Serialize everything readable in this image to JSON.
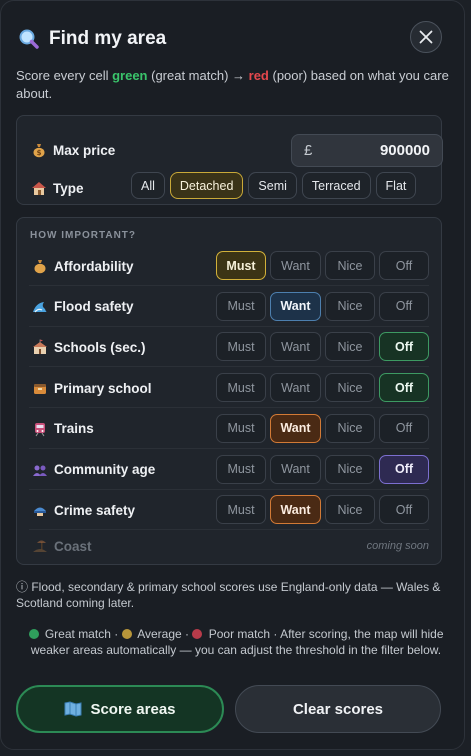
{
  "header": {
    "title": "Find my area",
    "icon": "magnifier-icon",
    "close_icon": "close-icon"
  },
  "description": {
    "part1": "Score every cell ",
    "green_word": "green",
    "part2": " (great match) → ",
    "red_word": "red",
    "part3": " (poor) based on what you care about."
  },
  "filters": {
    "max_price_label": "Max price",
    "currency": "£",
    "max_price_value": "900000",
    "type_label": "Type",
    "types": [
      "All",
      "Detached",
      "Semi",
      "Terraced",
      "Flat"
    ],
    "selected_type": "Detached"
  },
  "importance": {
    "heading": "HOW IMPORTANT?",
    "options": [
      "Must",
      "Want",
      "Nice",
      "Off"
    ],
    "rows": [
      {
        "label": "Affordability",
        "selected": "Must"
      },
      {
        "label": "Flood safety",
        "selected": "Want"
      },
      {
        "label": "Schools (sec.)",
        "selected": "Off"
      },
      {
        "label": "Primary school",
        "selected": "Off"
      },
      {
        "label": "Trains",
        "selected": "Want"
      },
      {
        "label": "Community age",
        "selected": "Off"
      },
      {
        "label": "Crime safety",
        "selected": "Want"
      }
    ],
    "coast_label": "Coast",
    "coast_status": "coming soon"
  },
  "note": "ⓘ Flood, secondary & primary school scores use England-only data — Wales & Scotland coming later.",
  "legend": {
    "great": "Great match",
    "average": "Average",
    "poor": "Poor match",
    "tail": "After scoring, the map will hide weaker areas automatically — you can adjust the threshold in the filter below.",
    "colors": {
      "great": "#2f9e5c",
      "average": "#b8963a",
      "poor": "#b83b4a"
    }
  },
  "actions": {
    "score_label": "Score areas",
    "clear_label": "Clear scores"
  },
  "colors": {
    "accent_green": "#2c8a55",
    "gold": "#c9a938",
    "orange": "#d27a36",
    "blue": "#4d7fae",
    "purple": "#7c6fd0"
  }
}
